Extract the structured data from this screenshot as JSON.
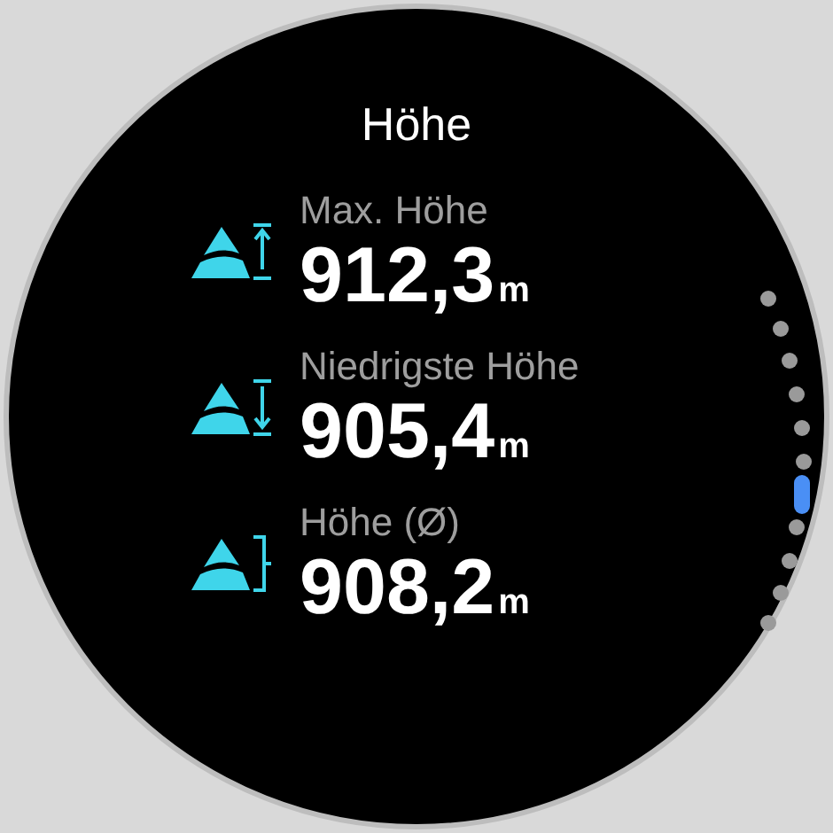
{
  "title": "Höhe",
  "metrics": [
    {
      "kind": "max",
      "label": "Max. Höhe",
      "value": "912,3",
      "unit": "m"
    },
    {
      "kind": "min",
      "label": "Niedrigste Höhe",
      "value": "905,4",
      "unit": "m"
    },
    {
      "kind": "avg",
      "label": "Höhe (Ø)",
      "value": "908,2",
      "unit": "m"
    }
  ],
  "page_indicator": [
    {
      "selected": false
    },
    {
      "selected": false
    },
    {
      "selected": false
    },
    {
      "selected": false
    },
    {
      "selected": false
    },
    {
      "selected": false
    },
    {
      "selected": true
    },
    {
      "selected": false
    },
    {
      "selected": false
    },
    {
      "selected": false
    },
    {
      "selected": false
    }
  ]
}
